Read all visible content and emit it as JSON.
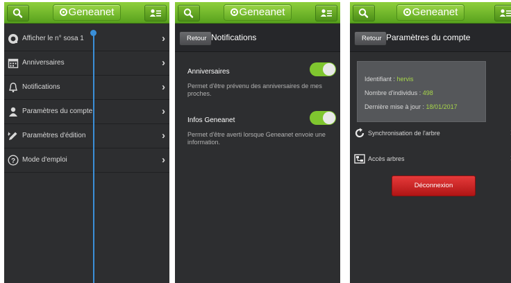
{
  "app": {
    "logo_text": "Geneanet"
  },
  "screen1": {
    "menu": [
      {
        "label": "Afficher le n° sosa 1",
        "icon": "sosa-icon"
      },
      {
        "label": "Anniversaires",
        "icon": "calendar-icon"
      },
      {
        "label": "Notifications",
        "icon": "bell-icon"
      },
      {
        "label": "Paramètres du compte",
        "icon": "user-icon"
      },
      {
        "label": "Paramètres d'édition",
        "icon": "edit-icon"
      },
      {
        "label": "Mode d'emploi",
        "icon": "help-icon"
      }
    ]
  },
  "screen2": {
    "back_label": "Retour",
    "title": "Notifications",
    "items": [
      {
        "title": "Anniversaires",
        "description": "Permet d'être prévenu des anniversaires de mes proches.",
        "enabled": true
      },
      {
        "title": "Infos Geneanet",
        "description": "Permet d'être averti lorsque Geneanet envoie une information.",
        "enabled": true
      }
    ]
  },
  "screen3": {
    "back_label": "Retour",
    "title": "Paramètres du compte",
    "info": {
      "identifiant_label": "Identifiant : ",
      "identifiant_value": "hervis",
      "individus_label": "Nombre d'individus : ",
      "individus_value": "498",
      "maj_label": "Dernière mise à jour : ",
      "maj_value": "18/01/2017"
    },
    "items": [
      {
        "label": "Synchronisation de l'arbre",
        "icon": "sync-icon"
      },
      {
        "label": "Accès arbres",
        "icon": "tree-access-icon"
      }
    ],
    "logout_label": "Déconnexion"
  },
  "colors": {
    "brand_green": "#6ab52a",
    "toggle_green": "#7fc62f",
    "accent_blue": "#3a8fd8",
    "danger_red": "#c82020"
  }
}
